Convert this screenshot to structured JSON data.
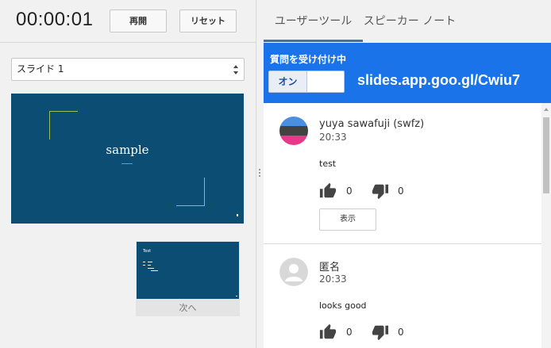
{
  "timer": {
    "value": "00:00:01"
  },
  "controls": {
    "resume_label": "再開",
    "reset_label": "リセット"
  },
  "slide_select": {
    "selected": "スライド 1"
  },
  "current_slide": {
    "title": "sample"
  },
  "next_slide": {
    "title": "Text",
    "label": "次へ"
  },
  "tabs": [
    {
      "label": "ユーザーツール",
      "active": true
    },
    {
      "label": "スピーカー ノート",
      "active": false
    }
  ],
  "qa": {
    "title": "質問を受け付け中",
    "toggle_on": "オン",
    "url": "slides.app.goo.gl/Cwiu7"
  },
  "questions": [
    {
      "author": "yuya sawafuji (swfz)",
      "time": "20:33",
      "text": "test",
      "upvotes": "0",
      "downvotes": "0",
      "show_label": "表示",
      "avatar_colors": [
        "#4a90e2",
        "#424242",
        "#e8388a"
      ]
    },
    {
      "author": "匿名",
      "time": "20:33",
      "text": "looks good",
      "upvotes": "0",
      "downvotes": "0",
      "avatar_colors": [
        "#d8d8d8",
        "#ffffff"
      ]
    }
  ],
  "colors": {
    "accent_blue": "#1a73e8",
    "slide_background": "#0c4d74",
    "slide_corner": "#9bbf57"
  }
}
